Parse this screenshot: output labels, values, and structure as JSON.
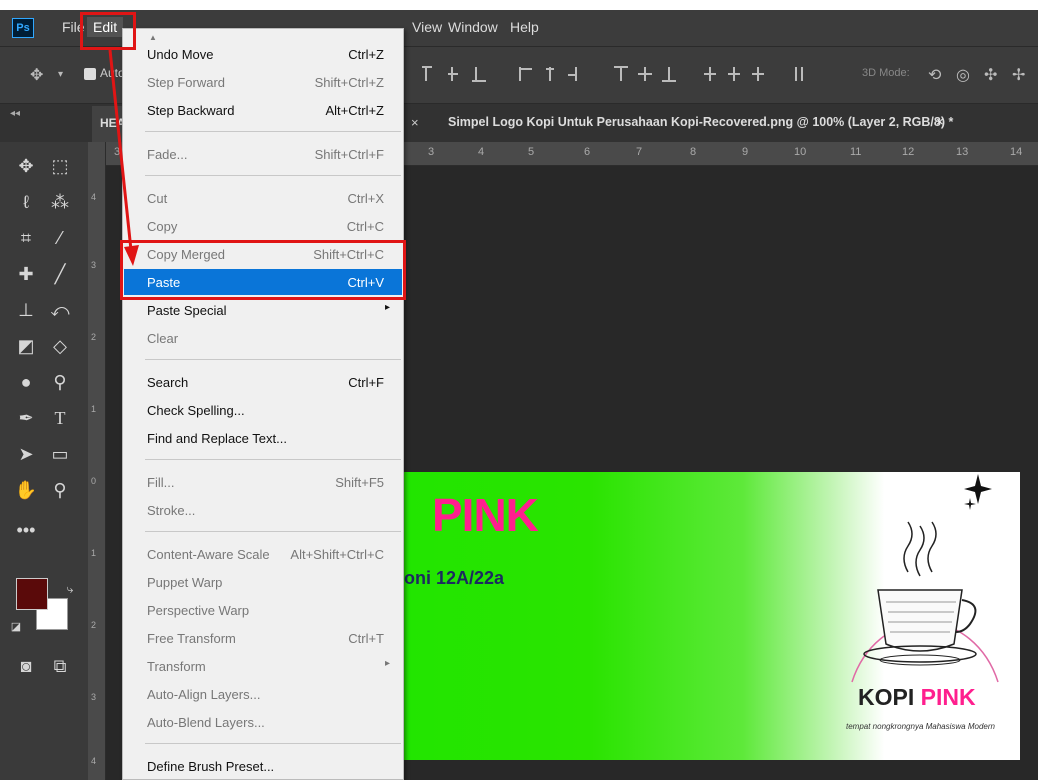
{
  "app": {
    "logo_text": "Ps",
    "menu": [
      "File",
      "Edit",
      "View",
      "Window",
      "Help"
    ]
  },
  "options_bar": {
    "auto_select_label": "Auto-",
    "mode_3d_label": "3D Mode:"
  },
  "tabs": {
    "first_label": "HEA",
    "first_close": "×",
    "doc_label": "Simpel Logo Kopi Untuk Perusahaan Kopi-Recovered.png @ 100% (Layer 2, RGB/8) *",
    "doc_close": "×"
  },
  "ruler": {
    "top": [
      "3",
      "4",
      "5",
      "6",
      "7",
      "8",
      "9",
      "10",
      "11",
      "12",
      "13",
      "14"
    ],
    "top_left_fragment": "3",
    "left": [
      "4",
      "3",
      "2",
      "1",
      "0",
      "1",
      "2",
      "3",
      "4"
    ]
  },
  "colors": {
    "foreground": "#5a0a0a",
    "background": "#ffffff",
    "highlight": "#0a75d8",
    "annotation": "#e01515"
  },
  "edit_menu": {
    "scroll_indicator": "▲",
    "items": [
      {
        "label": "Undo Move",
        "shortcut": "Ctrl+Z",
        "disabled": false
      },
      {
        "label": "Step Forward",
        "shortcut": "Shift+Ctrl+Z",
        "disabled": true
      },
      {
        "label": "Step Backward",
        "shortcut": "Alt+Ctrl+Z",
        "disabled": false
      },
      {
        "label": "Fade...",
        "shortcut": "Shift+Ctrl+F",
        "disabled": true
      },
      {
        "label": "Cut",
        "shortcut": "Ctrl+X",
        "disabled": true
      },
      {
        "label": "Copy",
        "shortcut": "Ctrl+C",
        "disabled": true
      },
      {
        "label": "Copy Merged",
        "shortcut": "Shift+Ctrl+C",
        "disabled": true
      },
      {
        "label": "Paste",
        "shortcut": "Ctrl+V",
        "disabled": false,
        "highlighted": true
      },
      {
        "label": "Paste Special",
        "shortcut": "",
        "disabled": false,
        "submenu": true
      },
      {
        "label": "Clear",
        "shortcut": "",
        "disabled": true
      },
      {
        "label": "Search",
        "shortcut": "Ctrl+F",
        "disabled": false
      },
      {
        "label": "Check Spelling...",
        "shortcut": "",
        "disabled": false
      },
      {
        "label": "Find and Replace Text...",
        "shortcut": "",
        "disabled": false
      },
      {
        "label": "Fill...",
        "shortcut": "Shift+F5",
        "disabled": true
      },
      {
        "label": "Stroke...",
        "shortcut": "",
        "disabled": true
      },
      {
        "label": "Content-Aware Scale",
        "shortcut": "Alt+Shift+Ctrl+C",
        "disabled": true
      },
      {
        "label": "Puppet Warp",
        "shortcut": "",
        "disabled": true
      },
      {
        "label": "Perspective Warp",
        "shortcut": "",
        "disabled": true
      },
      {
        "label": "Free Transform",
        "shortcut": "Ctrl+T",
        "disabled": true
      },
      {
        "label": "Transform",
        "shortcut": "",
        "disabled": true,
        "submenu": true
      },
      {
        "label": "Auto-Align Layers...",
        "shortcut": "",
        "disabled": true
      },
      {
        "label": "Auto-Blend Layers...",
        "shortcut": "",
        "disabled": true
      },
      {
        "label": "Define Brush Preset...",
        "shortcut": "",
        "disabled": false
      }
    ],
    "submenu_arrow": "▸"
  },
  "artwork": {
    "banner_title": "PINK",
    "banner_subtitle": "oni 12A/22a",
    "logo_word1": "KOPI",
    "logo_word2": "PINK",
    "logo_tagline": "tempat nongkrongnya Mahasiswa Modern"
  },
  "tools": [
    "move-icon",
    "marquee-icon",
    "lasso-icon",
    "magic-wand-icon",
    "crop-icon",
    "eyedropper-icon",
    "healing-brush-icon",
    "brush-icon",
    "stamp-icon",
    "history-brush-icon",
    "eraser-icon",
    "paint-bucket-icon",
    "blur-icon",
    "dodge-icon",
    "pen-icon",
    "type-icon",
    "path-select-icon",
    "rectangle-icon",
    "hand-icon",
    "zoom-icon",
    "more-tools-icon",
    "swap-colors-icon",
    "default-colors-icon",
    "quick-mask-icon",
    "screen-mode-icon"
  ]
}
